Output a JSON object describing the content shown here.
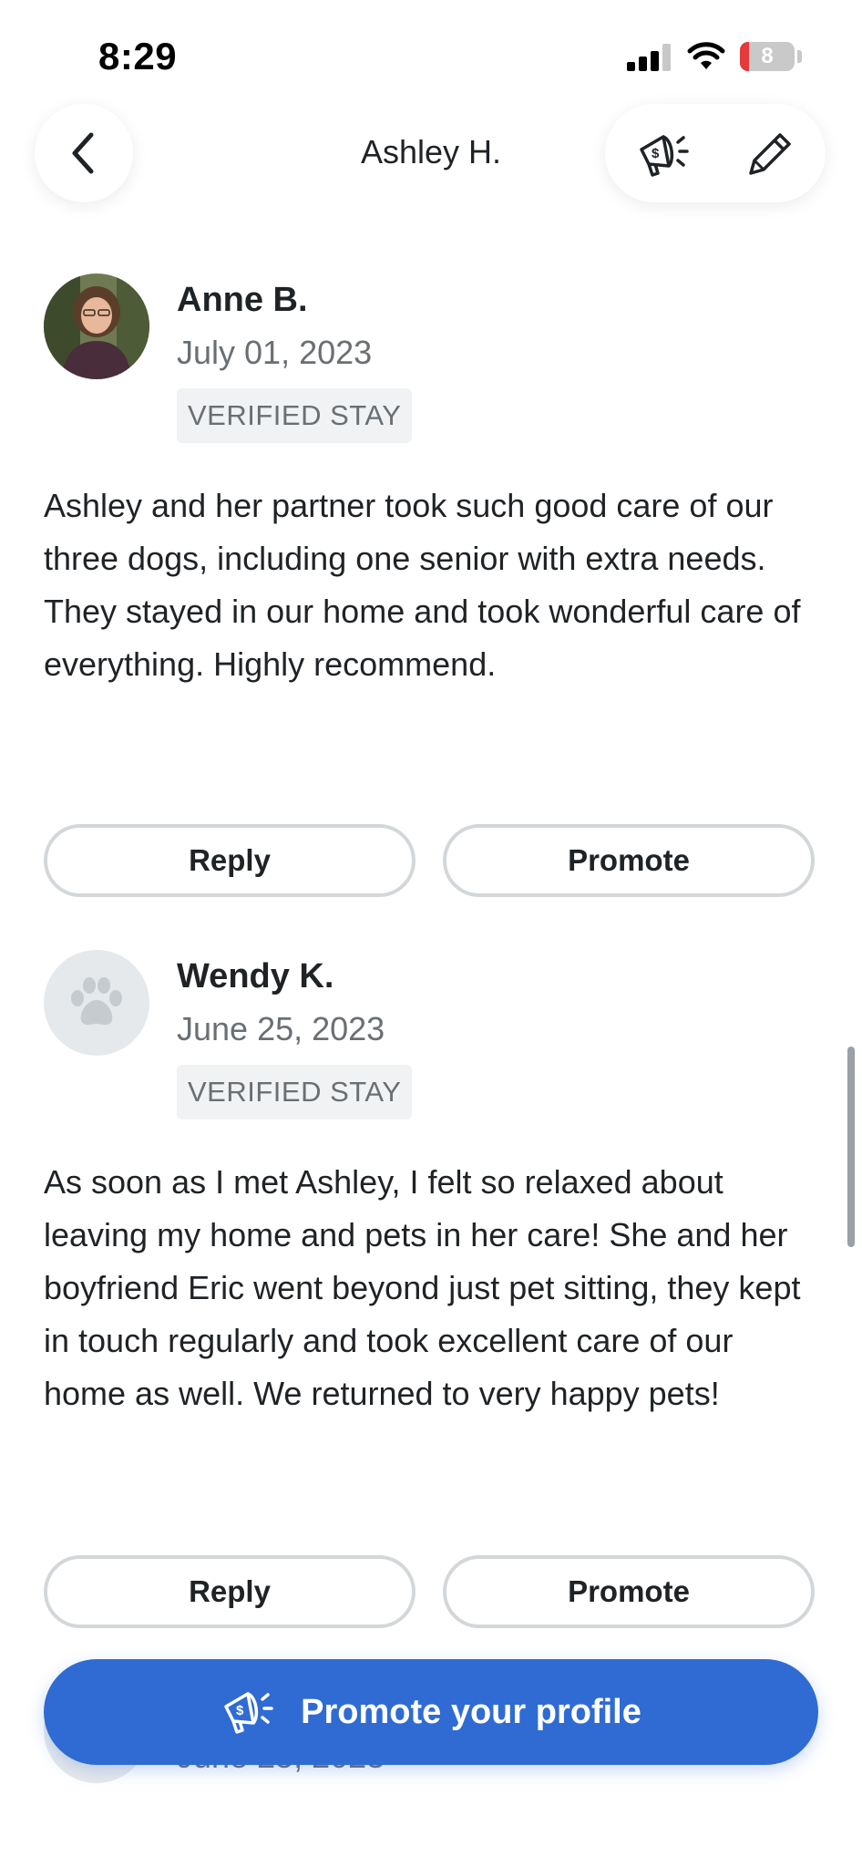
{
  "status_bar": {
    "time": "8:29",
    "battery_level": "8",
    "battery_color": "#e5393b"
  },
  "header": {
    "title": "Ashley H.",
    "back_icon": "chevron-left-icon",
    "promote_icon": "megaphone-dollar-icon",
    "edit_icon": "pencil-icon"
  },
  "reviews": [
    {
      "name": "Anne B.",
      "date": "July 01, 2023",
      "badge": "VERIFIED STAY",
      "avatar": "photo",
      "text": "Ashley and her partner took such good care of our three dogs, including one senior with extra needs. They stayed in our home and took wonderful care of everything. Highly recommend.",
      "reply_label": "Reply",
      "promote_label": "Promote"
    },
    {
      "name": "Wendy K.",
      "date": "June 25, 2023",
      "badge": "VERIFIED STAY",
      "avatar": "paw-icon",
      "text": "As soon as I met Ashley, I felt so relaxed about leaving my home and pets in her care! She and her boyfriend Eric went beyond just pet sitting, they kept in touch regularly and took excellent care of our home as well. We returned to very happy pets!",
      "reply_label": "Reply",
      "promote_label": "Promote"
    },
    {
      "date": "June 25, 2023"
    }
  ],
  "cta": {
    "label": "Promote your profile",
    "icon": "megaphone-dollar-icon",
    "color": "#2f6bd3"
  }
}
